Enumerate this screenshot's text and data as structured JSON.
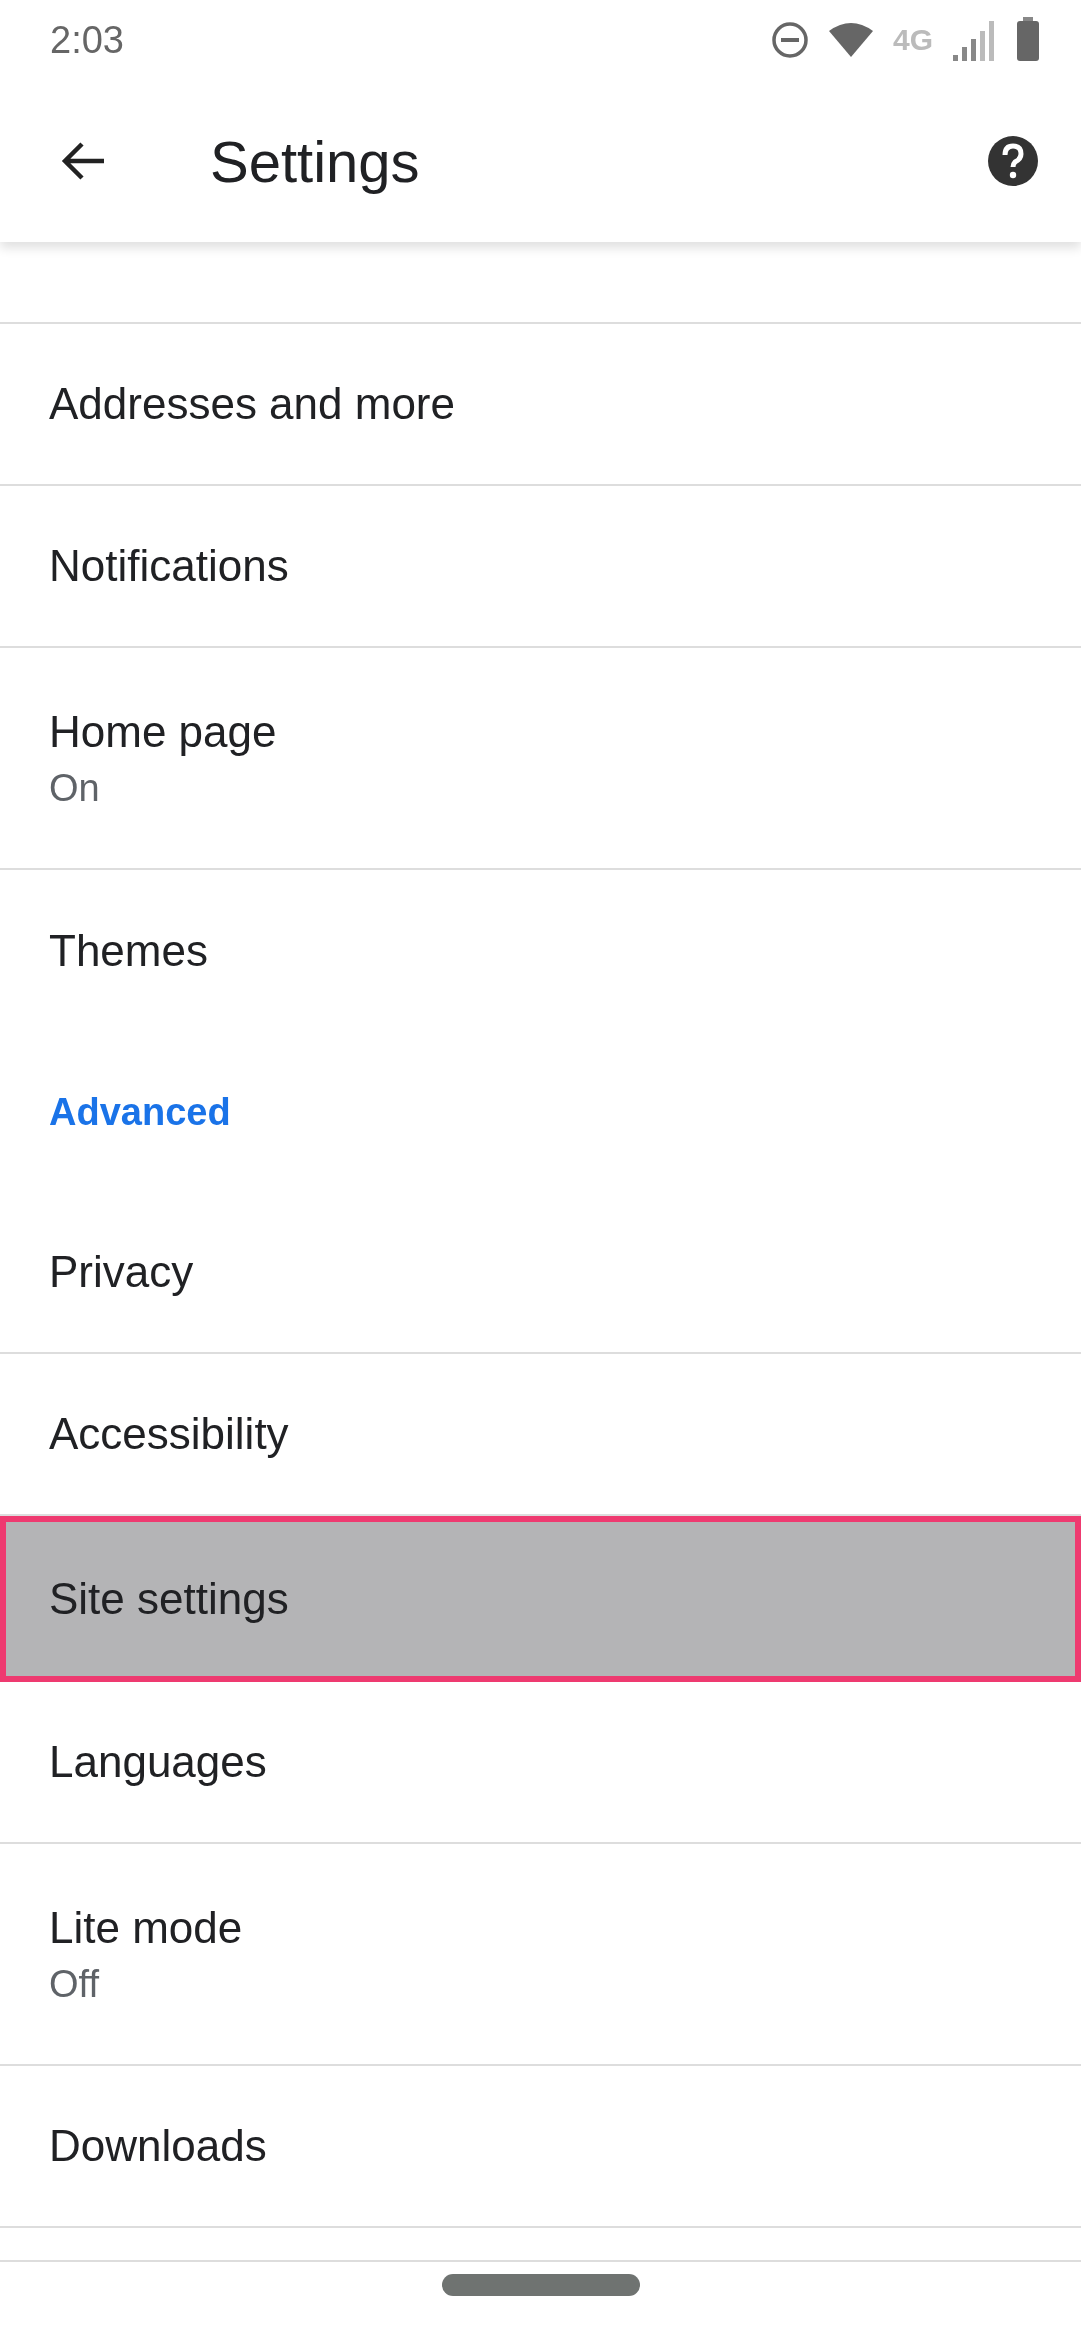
{
  "status_bar": {
    "time": "2:03",
    "network": "4G"
  },
  "app_bar": {
    "title": "Settings"
  },
  "items": [
    {
      "kind": "item",
      "title": "Addresses and more",
      "selected": false
    },
    {
      "kind": "item",
      "title": "Notifications",
      "selected": false
    },
    {
      "kind": "item",
      "title": "Home page",
      "subtitle": "On",
      "selected": false
    },
    {
      "kind": "item",
      "title": "Themes",
      "selected": false
    },
    {
      "kind": "header",
      "title": "Advanced"
    },
    {
      "kind": "item",
      "title": "Privacy",
      "selected": false
    },
    {
      "kind": "item",
      "title": "Accessibility",
      "selected": false
    },
    {
      "kind": "item",
      "title": "Site settings",
      "selected": true
    },
    {
      "kind": "item",
      "title": "Languages",
      "selected": false
    },
    {
      "kind": "item",
      "title": "Lite mode",
      "subtitle": "Off",
      "selected": false
    },
    {
      "kind": "item",
      "title": "Downloads",
      "selected": false
    }
  ]
}
